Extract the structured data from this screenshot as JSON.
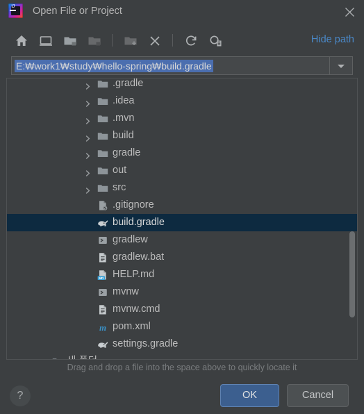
{
  "window": {
    "title": "Open File or Project",
    "logo_text": "IJ",
    "close_icon": "close-icon"
  },
  "toolbar": {
    "buttons": [
      {
        "name": "home-icon",
        "tooltip": "Home",
        "enabled": true
      },
      {
        "name": "desktop-icon",
        "tooltip": "Desktop",
        "enabled": true
      },
      {
        "name": "project-folder-icon",
        "tooltip": "Project Directory",
        "enabled": true
      },
      {
        "name": "module-folder-icon",
        "tooltip": "Module Directory",
        "enabled": false
      },
      {
        "name": "new-folder-icon",
        "tooltip": "New Folder",
        "enabled": false
      },
      {
        "name": "delete-icon",
        "tooltip": "Delete",
        "enabled": true
      },
      {
        "name": "refresh-icon",
        "tooltip": "Refresh",
        "enabled": true
      },
      {
        "name": "show-hidden-icon",
        "tooltip": "Show Hidden Files",
        "enabled": true
      }
    ],
    "hide_path_label": "Hide path"
  },
  "path_field": {
    "value": "E:\\work1\\study\\hello-spring\\build.gradle",
    "display_value": "E:₩work1₩study₩hello-spring₩build.gradle",
    "selected": true,
    "dropdown_icon": "chevron-down-icon"
  },
  "tree": {
    "rows": [
      {
        "label": ".gradle",
        "icon": "folder-icon",
        "expandable": true,
        "level": 1,
        "selected": false
      },
      {
        "label": ".idea",
        "icon": "folder-icon",
        "expandable": true,
        "level": 1,
        "selected": false
      },
      {
        "label": ".mvn",
        "icon": "folder-icon",
        "expandable": true,
        "level": 1,
        "selected": false
      },
      {
        "label": "build",
        "icon": "folder-icon",
        "expandable": true,
        "level": 1,
        "selected": false
      },
      {
        "label": "gradle",
        "icon": "folder-icon",
        "expandable": true,
        "level": 1,
        "selected": false
      },
      {
        "label": "out",
        "icon": "folder-icon",
        "expandable": true,
        "level": 1,
        "selected": false
      },
      {
        "label": "src",
        "icon": "folder-icon",
        "expandable": true,
        "level": 1,
        "selected": false
      },
      {
        "label": ".gitignore",
        "icon": "ignored-file-icon",
        "expandable": false,
        "level": 1,
        "selected": false
      },
      {
        "label": "build.gradle",
        "icon": "gradle-icon",
        "expandable": false,
        "level": 1,
        "selected": true
      },
      {
        "label": "gradlew",
        "icon": "shell-script-icon",
        "expandable": false,
        "level": 1,
        "selected": false
      },
      {
        "label": "gradlew.bat",
        "icon": "text-file-icon",
        "expandable": false,
        "level": 1,
        "selected": false
      },
      {
        "label": "HELP.md",
        "icon": "markdown-file-icon",
        "expandable": false,
        "level": 1,
        "selected": false
      },
      {
        "label": "mvnw",
        "icon": "shell-script-icon",
        "expandable": false,
        "level": 1,
        "selected": false
      },
      {
        "label": "mvnw.cmd",
        "icon": "text-file-icon",
        "expandable": false,
        "level": 1,
        "selected": false
      },
      {
        "label": "pom.xml",
        "icon": "maven-icon",
        "expandable": false,
        "level": 1,
        "selected": false
      },
      {
        "label": "settings.gradle",
        "icon": "gradle-icon",
        "expandable": false,
        "level": 1,
        "selected": false
      },
      {
        "label": "새 폴더",
        "icon": "folder-icon",
        "expandable": true,
        "level": 0,
        "selected": false
      }
    ],
    "markdown_badge": "MD",
    "maven_badge": "m"
  },
  "footer": {
    "drag_hint": "Drag and drop a file into the space above to quickly locate it",
    "help_label": "?",
    "ok_label": "OK",
    "cancel_label": "Cancel"
  },
  "colors": {
    "window_bg": "#3c3f41",
    "selection_row": "#0d2a40",
    "text_selection": "#4b6eaf",
    "link": "#4a88c7",
    "ok_button": "#3c5f8f",
    "cancel_button": "#4c5052",
    "folder_icon": "#8d9499",
    "maven_icon": "#3a8fc4",
    "markdown_badge": "#379fd6"
  }
}
